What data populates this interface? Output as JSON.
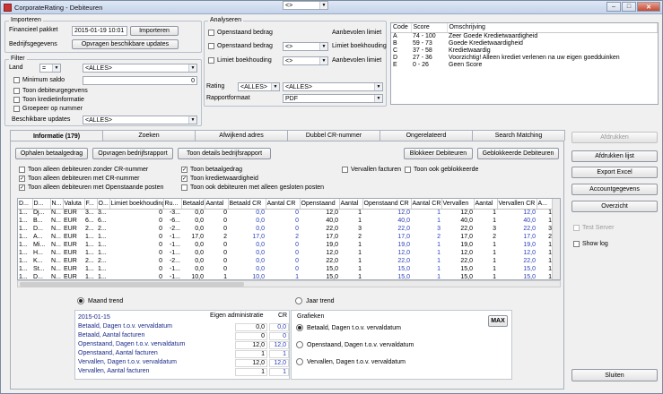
{
  "window": {
    "title": "CorporateRating - Debiteuren"
  },
  "importeren": {
    "legend": "Importeren",
    "financieel_pakket_label": "Financieel pakket",
    "financieel_pakket_value": "2015-01-19 10:01",
    "importeren_button": "Importeren",
    "bedrijfsgegevens_label": "Bedrijfsgegevens",
    "opvragen_button": "Opvragen beschikbare updates"
  },
  "filter": {
    "legend": "Filter",
    "land_label": "Land",
    "land_op": "=",
    "land_value": "<ALLES>",
    "minimum_saldo_label": "Minimum saldo",
    "minimum_saldo_value": "0",
    "toon_debiteurgegevens": "Toon debiteurgegevens",
    "toon_kredietinformatie": "Toon kredietinformatie",
    "groepeer_op_nummer": "Groepeer op nummer",
    "beschikbare_updates_label": "Beschikbare updates",
    "beschikbare_updates_value": "<ALLES>"
  },
  "analyseren": {
    "legend": "Analyseren",
    "rows": [
      {
        "label": "Openstaand bedrag",
        "op": "<>",
        "right": "Aanbevolen limiet"
      },
      {
        "label": "Openstaand bedrag",
        "op": "<>",
        "right": "Limiet boekhouding"
      },
      {
        "label": "Limiet boekhouding",
        "op": "<>",
        "right": "Aanbevolen limiet"
      }
    ],
    "rating_label": "Rating",
    "rating_op": "<ALLES>",
    "rating_value": "<ALLES>",
    "rapportformaat_label": "Rapportformaat",
    "rapportformaat_value": "PDF"
  },
  "codes": {
    "headers": [
      "Code",
      "Score",
      "Omschrijving"
    ],
    "rows": [
      [
        "A",
        "74 - 100",
        "Zeer Goede Kredietwaardigheid"
      ],
      [
        "B",
        "59 - 73",
        "Goede Kredietwaardigheid"
      ],
      [
        "C",
        "37 - 58",
        "Kredietwaardig"
      ],
      [
        "D",
        "27 - 36",
        "Voorzichtig! Alleen krediet verlenen na uw eigen goedduinken"
      ],
      [
        "E",
        "0 - 26",
        "Geen Score"
      ]
    ]
  },
  "tabs": [
    "Informatie (179)",
    "Zoeken",
    "Afwijkend adres",
    "Dubbel CR-nummer",
    "Ongerelateerd",
    "Search Matching"
  ],
  "toolbar": {
    "ophalen": "Ophalen betaalgedrag",
    "opvragen": "Opvragen bedrijfsrapport",
    "toon_details": "Toon details bedrijfsrapport",
    "blokkeer": "Blokkeer Debiteuren",
    "geblokkeerde": "Geblokkeerde Debiteuren"
  },
  "options": [
    {
      "label": "Toon alleen debiteuren zonder CR-nummer",
      "checked": false
    },
    {
      "label": "Toon alleen debiteuren met CR-nummer",
      "checked": true
    },
    {
      "label": "Toon alleen debiteuren met Openstaande posten",
      "checked": true
    },
    {
      "label": "Toon betaalgedrag",
      "checked": true
    },
    {
      "label": "Toon kredietwaardigheid",
      "checked": true
    },
    {
      "label": "Toon ook debiteuren met alleen gesloten posten",
      "checked": false
    },
    {
      "label": "Vervallen facturen",
      "checked": false
    },
    {
      "label": "Toon ook geblokkeerde",
      "checked": false
    }
  ],
  "grid": {
    "headers": [
      "D...",
      "D...",
      "N...",
      "Valuta",
      "F...",
      "O...",
      "Limiet boekhouding",
      "Ru...",
      "Betaald",
      "Aantal",
      "Betaald CR",
      "Aantal CR",
      "Openstaand",
      "Aantal",
      "Openstaand CR",
      "Aantal CR",
      "Vervallen",
      "Aantal",
      "Vervallen CR",
      "A..."
    ],
    "rows": [
      [
        "1...",
        "Dj...",
        "N...",
        "EUR",
        "3...",
        "3...",
        "0",
        "-3...",
        "0,0",
        "0",
        "0,0",
        "0",
        "12,0",
        "1",
        "12,0",
        "1",
        "12,0",
        "1",
        "12,0",
        "1"
      ],
      [
        "1...",
        "B...",
        "N...",
        "EUR",
        "6...",
        "6...",
        "0",
        "-6...",
        "0,0",
        "0",
        "0,0",
        "0",
        "40,0",
        "1",
        "40,0",
        "1",
        "40,0",
        "1",
        "40,0",
        "1"
      ],
      [
        "1...",
        "D...",
        "N...",
        "EUR",
        "2...",
        "2...",
        "0",
        "-2...",
        "0,0",
        "0",
        "0,0",
        "0",
        "22,0",
        "3",
        "22,0",
        "3",
        "22,0",
        "3",
        "22,0",
        "3"
      ],
      [
        "1...",
        "A...",
        "N...",
        "EUR",
        "1...",
        "1...",
        "0",
        "-1...",
        "17,0",
        "2",
        "17,0",
        "2",
        "17,0",
        "2",
        "17,0",
        "2",
        "17,0",
        "2",
        "17,0",
        "2"
      ],
      [
        "1...",
        "Mi...",
        "N...",
        "EUR",
        "1...",
        "1...",
        "0",
        "-1...",
        "0,0",
        "0",
        "0,0",
        "0",
        "19,0",
        "1",
        "19,0",
        "1",
        "19,0",
        "1",
        "19,0",
        "1"
      ],
      [
        "1...",
        "H...",
        "N...",
        "EUR",
        "1...",
        "1...",
        "0",
        "-1...",
        "0,0",
        "0",
        "0,0",
        "0",
        "12,0",
        "1",
        "12,0",
        "1",
        "12,0",
        "1",
        "12,0",
        "1"
      ],
      [
        "1...",
        "K...",
        "N...",
        "EUR",
        "2...",
        "2...",
        "0",
        "-2...",
        "0,0",
        "0",
        "0,0",
        "0",
        "22,0",
        "1",
        "22,0",
        "1",
        "22,0",
        "1",
        "22,0",
        "1"
      ],
      [
        "1...",
        "St...",
        "N...",
        "EUR",
        "1...",
        "1...",
        "0",
        "-1...",
        "0,0",
        "0",
        "0,0",
        "0",
        "15,0",
        "1",
        "15,0",
        "1",
        "15,0",
        "1",
        "15,0",
        "1"
      ],
      [
        "1...",
        "D...",
        "N...",
        "EUR",
        "1...",
        "1...",
        "0",
        "-1...",
        "10,0",
        "1",
        "10,0",
        "1",
        "15,0",
        "1",
        "15,0",
        "1",
        "15,0",
        "1",
        "15,0",
        "1"
      ]
    ]
  },
  "trend": {
    "maand": "Maand trend",
    "jaar": "Jaar trend",
    "date": "2015-01-15",
    "col_eigen": "Eigen administratie",
    "col_cr": "CR",
    "rows": [
      {
        "label": "Betaald, Dagen t.o.v. vervaldatum",
        "v1": "0,0",
        "v2": "0,0"
      },
      {
        "label": "Betaald, Aantal facturen",
        "v1": "0",
        "v2": "0"
      },
      {
        "label": "Openstaand, Dagen t.o.v. vervaldatum",
        "v1": "12,0",
        "v2": "12,0"
      },
      {
        "label": "Openstaand, Aantal facturen",
        "v1": "1",
        "v2": "1"
      },
      {
        "label": "Vervallen, Dagen t.o.v. vervaldatum",
        "v1": "12,0",
        "v2": "12,0"
      },
      {
        "label": "Vervallen, Aantal facturen",
        "v1": "1",
        "v2": "1"
      }
    ]
  },
  "grafieken": {
    "title": "Grafieken",
    "max": "MAX",
    "options": [
      "Betaald, Dagen t.o.v. vervaldatum",
      "Openstaand, Dagen t.o.v. vervaldatum",
      "Vervallen, Dagen t.o.v. vervaldatum"
    ]
  },
  "right": {
    "afdrukken": "Afdrukken",
    "afdrukken_lijst": "Afdrukken lijst",
    "export_excel": "Export Excel",
    "accountgegevens": "Accountgegevens",
    "overzicht": "Overzicht",
    "test_server": "Test Server",
    "show_log": "Show log",
    "sluiten": "Sluiten"
  }
}
